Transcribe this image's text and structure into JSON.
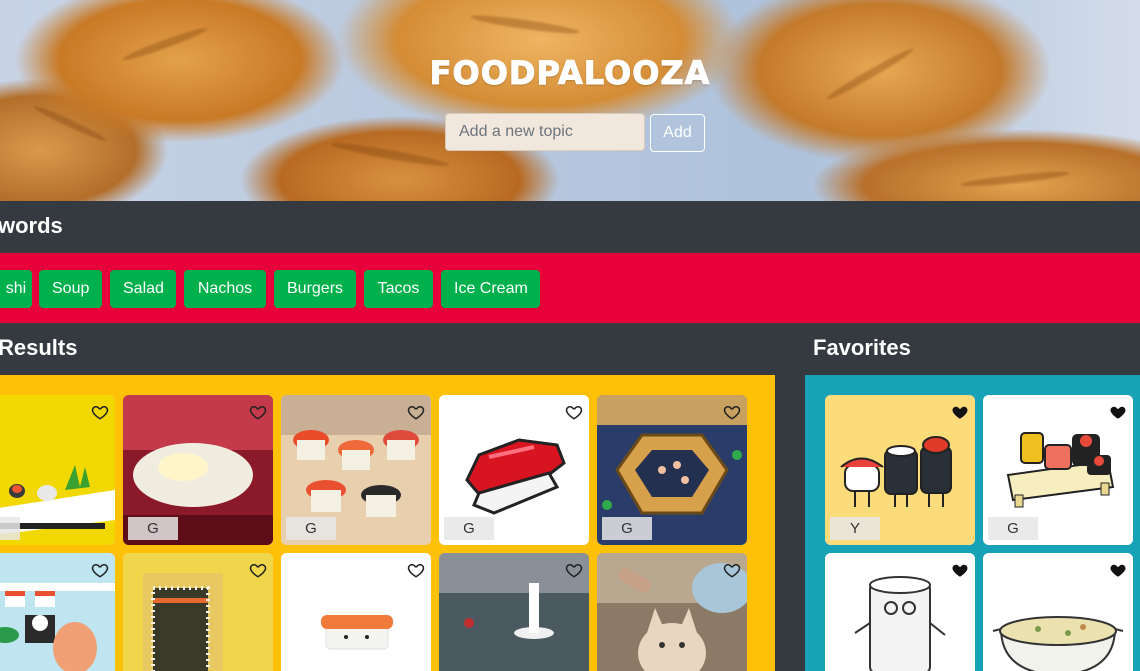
{
  "header": {
    "title": "FOODPALOOZA",
    "input_placeholder": "Add a new topic",
    "add_label": "Add"
  },
  "keywords": {
    "heading": "words",
    "buttons": [
      "shi",
      "Soup",
      "Salad",
      "Nachos",
      "Burgers",
      "Tacos",
      "Ice Cream"
    ]
  },
  "results": {
    "heading": "Results",
    "cards": [
      {
        "rating": "",
        "favorited": false
      },
      {
        "rating": "G",
        "favorited": false
      },
      {
        "rating": "G",
        "favorited": false
      },
      {
        "rating": "G",
        "favorited": false
      },
      {
        "rating": "G",
        "favorited": false
      },
      {
        "rating": "",
        "favorited": false
      },
      {
        "rating": "",
        "favorited": false
      },
      {
        "rating": "",
        "favorited": false
      },
      {
        "rating": "",
        "favorited": false
      },
      {
        "rating": "",
        "favorited": false
      }
    ]
  },
  "favorites": {
    "heading": "Favorites",
    "cards": [
      {
        "rating": "Y",
        "favorited": true
      },
      {
        "rating": "G",
        "favorited": true
      },
      {
        "rating": "",
        "favorited": true
      },
      {
        "rating": "",
        "favorited": true
      }
    ]
  },
  "colors": {
    "dark_bar": "#343a40",
    "keywords_strip": "#e8003a",
    "keyword_button": "#00b04c",
    "results_panel": "#ffc107",
    "favorites_panel": "#17a2b8"
  }
}
